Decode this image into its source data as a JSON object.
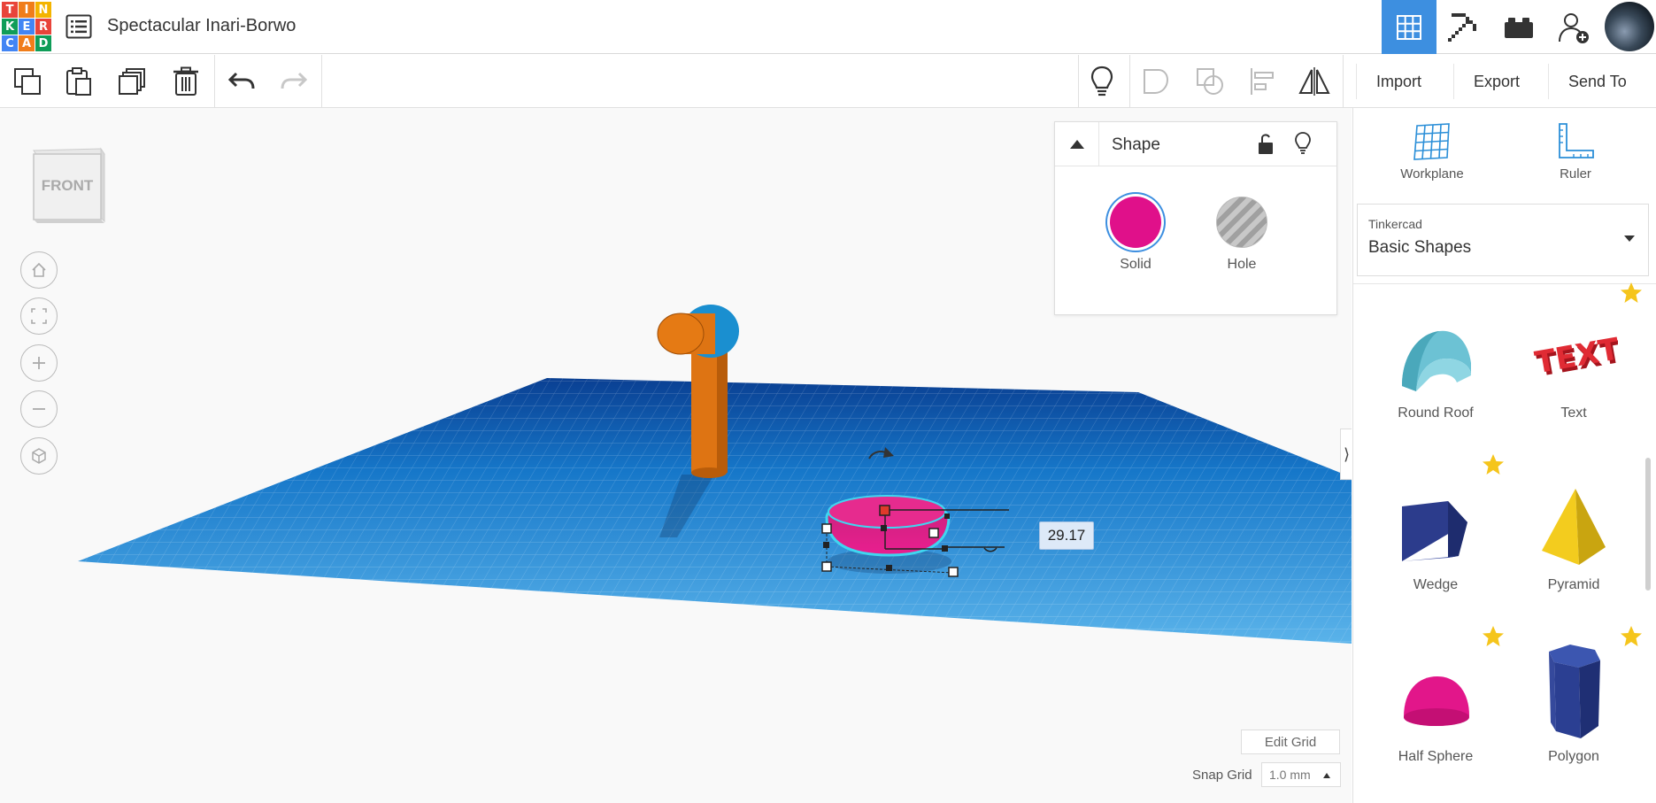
{
  "app": {
    "logo_letters": [
      "T",
      "I",
      "N",
      "K",
      "E",
      "R",
      "C",
      "A",
      "D"
    ],
    "logo_colors": [
      "#e8443a",
      "#f07d1a",
      "#f4b400",
      "#0f9d58",
      "#4285f4",
      "#e8443a",
      "#4285f4",
      "#f07d1a",
      "#0f9d58"
    ],
    "design_title": "Spectacular Inari-Borwo"
  },
  "nav": {
    "active": "3d-design",
    "accent_color": "#3d8fe0",
    "items": [
      "grid-icon",
      "pickaxe-icon",
      "bricks-icon",
      "add-user-icon"
    ]
  },
  "toolbar": {
    "import_label": "Import",
    "export_label": "Export",
    "send_to_label": "Send To"
  },
  "viewcube": {
    "face_label": "FRONT"
  },
  "shape_panel": {
    "title": "Shape",
    "solid_label": "Solid",
    "hole_label": "Hole",
    "solid_color": "#e0108a"
  },
  "viewport": {
    "dimension_value": "29.17",
    "edit_grid_label": "Edit Grid",
    "snap_grid_label": "Snap Grid",
    "snap_grid_value": "1.0 mm"
  },
  "sidebar": {
    "workplane_label": "Workplane",
    "ruler_label": "Ruler",
    "library_provider": "Tinkercad",
    "library_name": "Basic Shapes",
    "shapes": [
      {
        "name": "Round Roof"
      },
      {
        "name": "Text"
      },
      {
        "name": "Wedge"
      },
      {
        "name": "Pyramid"
      },
      {
        "name": "Half Sphere"
      },
      {
        "name": "Polygon"
      }
    ]
  }
}
